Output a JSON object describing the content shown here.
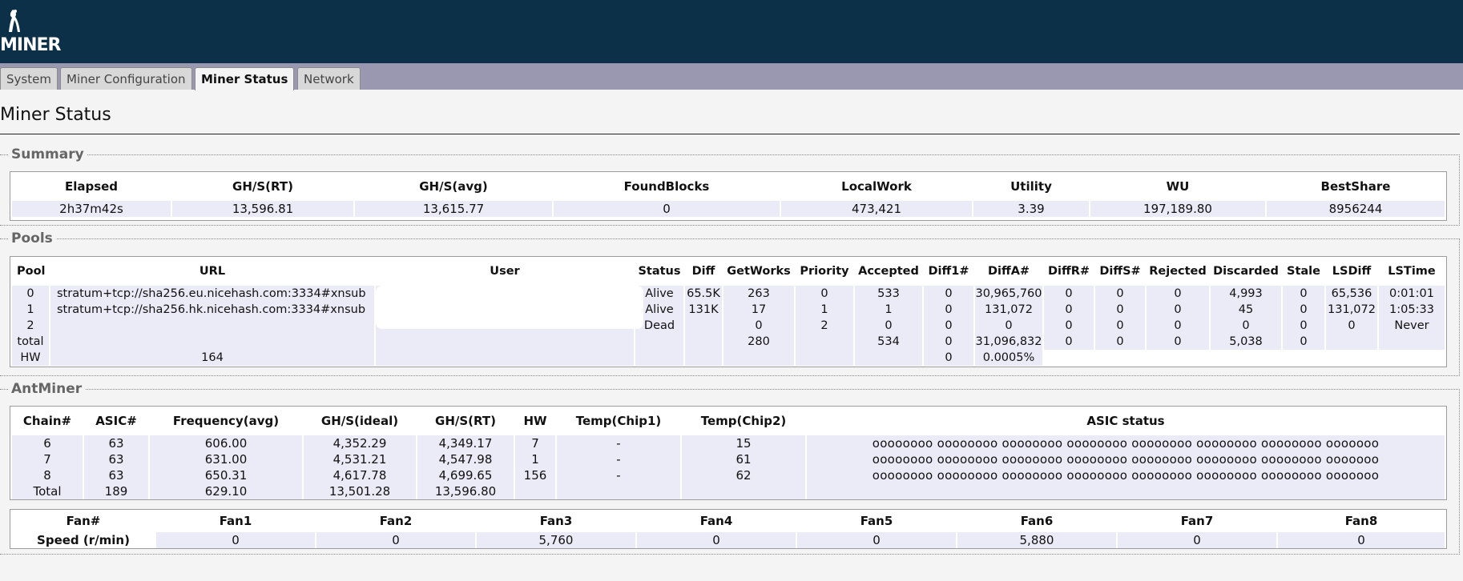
{
  "brand": {
    "logo_text": "MINER"
  },
  "tabs": [
    {
      "label": "System",
      "active": false
    },
    {
      "label": "Miner Configuration",
      "active": false
    },
    {
      "label": "Miner Status",
      "active": true
    },
    {
      "label": "Network",
      "active": false
    }
  ],
  "page_title": "Miner Status",
  "summary": {
    "legend": "Summary",
    "headers": [
      "Elapsed",
      "GH/S(RT)",
      "GH/S(avg)",
      "FoundBlocks",
      "LocalWork",
      "Utility",
      "WU",
      "BestShare"
    ],
    "values": [
      "2h37m42s",
      "13,596.81",
      "13,615.77",
      "0",
      "473,421",
      "3.39",
      "197,189.80",
      "8956244"
    ]
  },
  "pools": {
    "legend": "Pools",
    "headers": [
      "Pool",
      "URL",
      "User",
      "Status",
      "Diff",
      "GetWorks",
      "Priority",
      "Accepted",
      "Diff1#",
      "DiffA#",
      "DiffR#",
      "DiffS#",
      "Rejected",
      "Discarded",
      "Stale",
      "LSDiff",
      "LSTime"
    ],
    "rows": [
      [
        "0",
        "stratum+tcp://sha256.eu.nicehash.com:3334#xnsub",
        "",
        "Alive",
        "65.5K",
        "263",
        "0",
        "533",
        "0",
        "30,965,760",
        "0",
        "0",
        "0",
        "4,993",
        "0",
        "65,536",
        "0:01:01"
      ],
      [
        "1",
        "stratum+tcp://sha256.hk.nicehash.com:3334#xnsub",
        "",
        "Alive",
        "131K",
        "17",
        "1",
        "1",
        "0",
        "131,072",
        "0",
        "0",
        "0",
        "45",
        "0",
        "131,072",
        "1:05:33"
      ],
      [
        "2",
        "",
        "",
        "Dead",
        "",
        "0",
        "2",
        "0",
        "0",
        "0",
        "0",
        "0",
        "0",
        "0",
        "0",
        "0",
        "Never"
      ],
      [
        "total",
        "",
        "",
        "",
        "",
        "280",
        "",
        "534",
        "0",
        "31,096,832",
        "0",
        "0",
        "0",
        "5,038",
        "0",
        "",
        ""
      ]
    ],
    "hw_row": {
      "label": "HW",
      "value": "164",
      "diff1": "0",
      "diffa": "0.0005%"
    }
  },
  "antminer": {
    "legend": "AntMiner",
    "headers": [
      "Chain#",
      "ASIC#",
      "Frequency(avg)",
      "GH/S(ideal)",
      "GH/S(RT)",
      "HW",
      "Temp(Chip1)",
      "Temp(Chip2)",
      "ASIC status"
    ],
    "rows": [
      [
        "6",
        "63",
        "606.00",
        "4,352.29",
        "4,349.17",
        "7",
        "-",
        "15",
        "oooooooo oooooooo oooooooo oooooooo oooooooo oooooooo oooooooo ooooooo"
      ],
      [
        "7",
        "63",
        "631.00",
        "4,531.21",
        "4,547.98",
        "1",
        "-",
        "61",
        "oooooooo oooooooo oooooooo oooooooo oooooooo oooooooo oooooooo ooooooo"
      ],
      [
        "8",
        "63",
        "650.31",
        "4,617.78",
        "4,699.65",
        "156",
        "-",
        "62",
        "oooooooo oooooooo oooooooo oooooooo oooooooo oooooooo oooooooo ooooooo"
      ],
      [
        "Total",
        "189",
        "629.10",
        "13,501.28",
        "13,596.80",
        "",
        "",
        "",
        ""
      ]
    ]
  },
  "fans": {
    "headers": [
      "Fan#",
      "Fan1",
      "Fan2",
      "Fan3",
      "Fan4",
      "Fan5",
      "Fan6",
      "Fan7",
      "Fan8"
    ],
    "speed_label": "Speed (r/min)",
    "values": [
      "0",
      "0",
      "5,760",
      "0",
      "0",
      "5,880",
      "0",
      "0"
    ]
  }
}
